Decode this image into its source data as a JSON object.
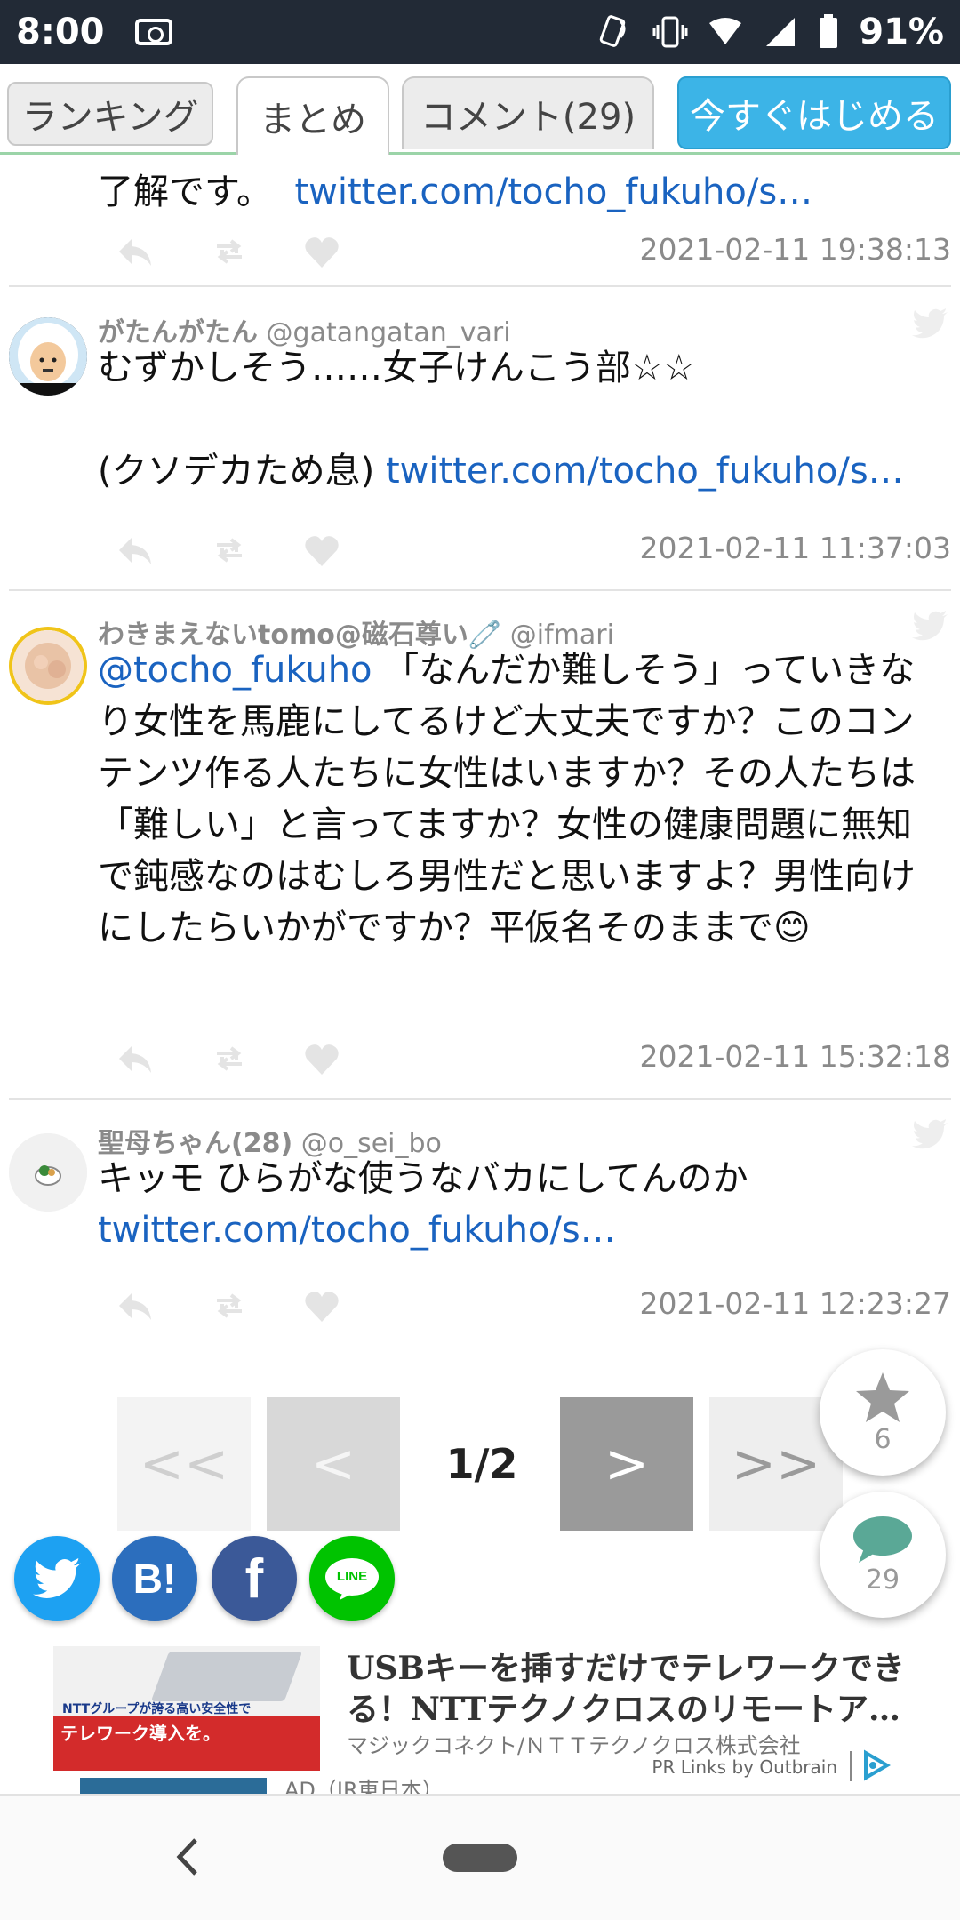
{
  "status_bar": {
    "time": "8:00",
    "battery_percent": "91%",
    "icons": [
      "camera-icon",
      "nfc-icon",
      "vibrate-icon",
      "wifi-icon",
      "signal-icon",
      "battery-icon"
    ]
  },
  "tabs": {
    "ranking": "ランキング",
    "matome": "まとめ",
    "comment": "コメント(29)",
    "cta": "今すぐはじめる"
  },
  "tweets": [
    {
      "body_text": "了解です。",
      "link": "twitter.com/tocho_fukuho/s…",
      "timestamp": "2021-02-11 19:38:13"
    },
    {
      "display_name": "がたんがたん",
      "handle": "@gatangatan_vari",
      "line1": "むずかしそう……女子けんこう部☆☆",
      "line2": "(クソデカため息)",
      "link": "twitter.com/tocho_fukuho/s…",
      "timestamp": "2021-02-11 11:37:03"
    },
    {
      "display_name": "わきまえないtomo@磁石尊い🧷",
      "handle": "@ifmari",
      "mention": "@tocho_fukuho",
      "body_text": "「なんだか難しそう」っていきなり女性を馬鹿にしてるけど大丈夫ですか？このコンテンツ作る人たちに女性はいますか？その人たちは「難しい」と言ってますか？女性の健康問題に無知で鈍感なのはむしろ男性だと思いますよ？男性向けにしたらいかがですか？平仮名そのままで😊",
      "timestamp": "2021-02-11 15:32:18"
    },
    {
      "display_name": "聖母ちゃん(28)",
      "handle": "@o_sei_bo",
      "body_text": "キッモ ひらがな使うなバカにしてんのか",
      "link": "twitter.com/tocho_fukuho/s…",
      "timestamp": "2021-02-11 12:23:27"
    }
  ],
  "pagination": {
    "first": "<<",
    "prev": "<",
    "current": "1/2",
    "next": ">",
    "last": ">>"
  },
  "floating": {
    "star_count": "6",
    "comment_count": "29"
  },
  "share": {
    "hatena": "B!",
    "facebook": "f",
    "line": "LINE"
  },
  "ad": {
    "title": "USBキーを挿すだけでテレワークできる！NTTテクノクロスのリモートア…",
    "sponsor": "マジックコネクト/ＮＴＴテクノクロス株式会社",
    "provider": "PR Links by Outbrain",
    "image_line1": "NTTグループが誇る高い安全性で",
    "image_line2": "テレワーク導入を。",
    "next_ad_peek": "AD（JR東日本）"
  },
  "colors": {
    "status_bar_bg": "#222a36",
    "cta_bg": "#3cb4e7",
    "link": "#1a63c0",
    "twitter": "#1da1f2",
    "hatena": "#2c6ebd",
    "facebook": "#3b5998",
    "line": "#00c300"
  }
}
